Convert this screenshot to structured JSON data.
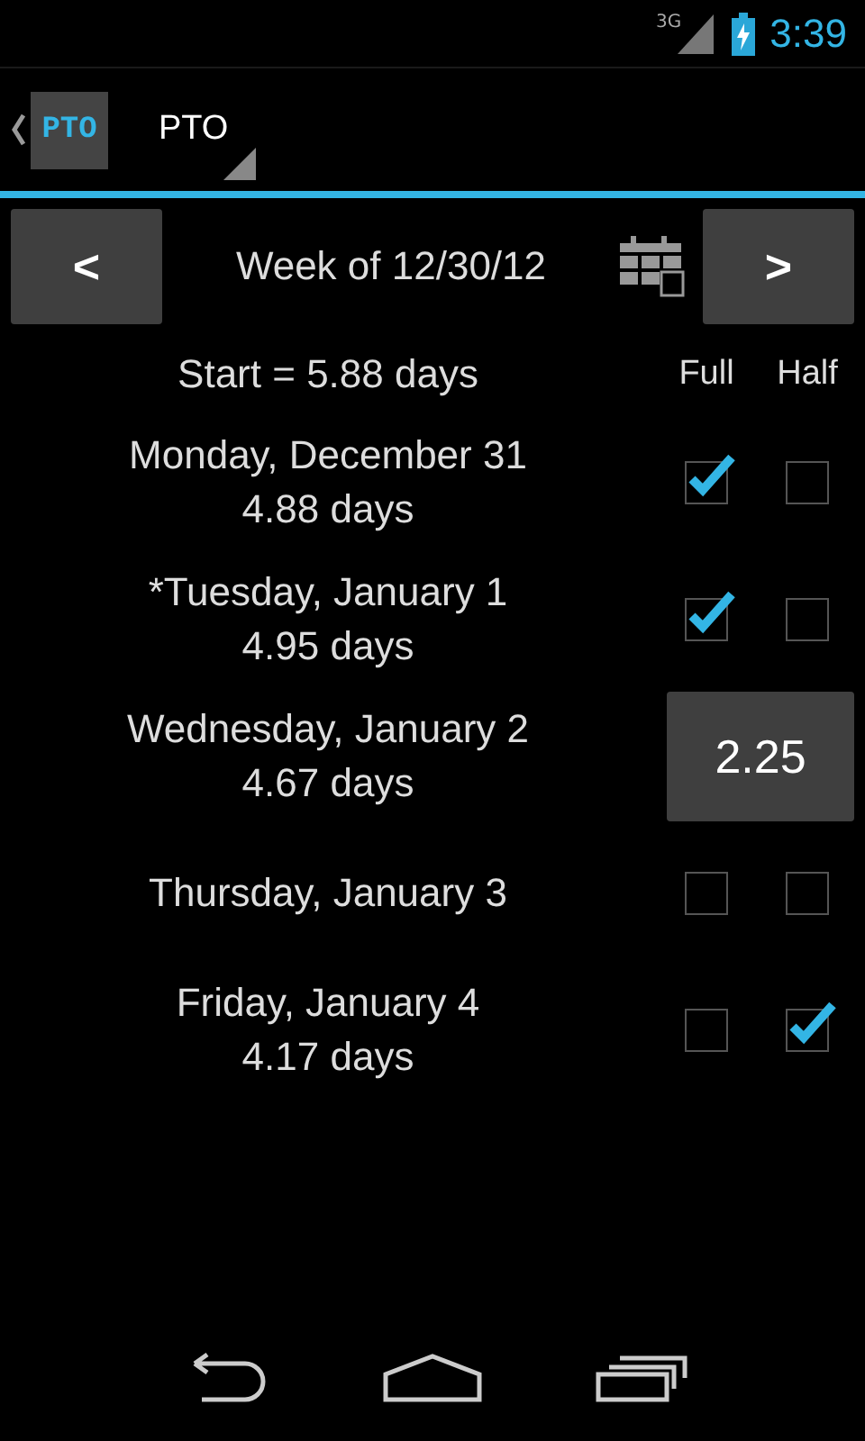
{
  "status_bar": {
    "network": "3G",
    "time": "3:39"
  },
  "action_bar": {
    "icon_text": "PTO",
    "title": "PTO"
  },
  "week_nav": {
    "prev": "<",
    "label": "Week of 12/30/12",
    "next": ">"
  },
  "summary": "Start = 5.88 days",
  "columns": [
    "Full",
    "Half"
  ],
  "days": [
    {
      "kind": "checkboxes",
      "name": "Monday, December 31",
      "balance": "4.88 days",
      "full": true,
      "half": false
    },
    {
      "kind": "checkboxes",
      "name": "*Tuesday, January 1",
      "balance": "4.95 days",
      "full": true,
      "half": false
    },
    {
      "kind": "hours",
      "name": "Wednesday, January 2",
      "balance": "4.67 days",
      "value": "2.25"
    },
    {
      "kind": "checkboxes",
      "name": "Thursday, January 3",
      "full": false,
      "half": false
    },
    {
      "kind": "checkboxes",
      "name": "Friday, January 4",
      "balance": "4.17 days",
      "full": false,
      "half": true
    }
  ]
}
